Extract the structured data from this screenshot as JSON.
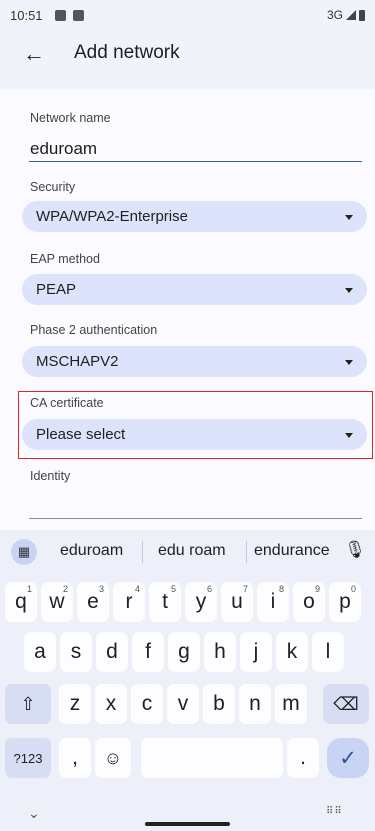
{
  "status_bar": {
    "time": "10:51",
    "network": "3G"
  },
  "app_bar": {
    "title": "Add network"
  },
  "form": {
    "network_name_label": "Network name",
    "network_name_value": "eduroam",
    "security_label": "Security",
    "security_value": "WPA/WPA2-Enterprise",
    "eap_label": "EAP method",
    "eap_value": "PEAP",
    "phase2_label": "Phase 2 authentication",
    "phase2_value": "MSCHAPV2",
    "ca_label": "CA certificate",
    "ca_value": "Please select",
    "identity_label": "Identity"
  },
  "keyboard": {
    "suggestions": [
      "eduroam",
      "edu roam",
      "endurance"
    ],
    "row1": [
      "q",
      "w",
      "e",
      "r",
      "t",
      "y",
      "u",
      "i",
      "o",
      "p"
    ],
    "row1_sup": [
      "1",
      "2",
      "3",
      "4",
      "5",
      "6",
      "7",
      "8",
      "9",
      "0"
    ],
    "row2": [
      "a",
      "s",
      "d",
      "f",
      "g",
      "h",
      "j",
      "k",
      "l"
    ],
    "row3": [
      "z",
      "x",
      "c",
      "v",
      "b",
      "n",
      "m"
    ],
    "symbols_label": "?123",
    "comma": ",",
    "period": ".",
    "emoji": "☺"
  },
  "icons": {
    "back": "arrow-left-icon",
    "caret": "caret-down-icon",
    "grid": "apps-grid-icon",
    "mic": "microphone-icon",
    "shift": "shift-icon",
    "backspace": "backspace-icon",
    "enter": "check-icon"
  },
  "colors": {
    "dropdown_bg": "#dde3fb",
    "highlight": "#e32222",
    "enter_key": "#c9d4f4"
  }
}
